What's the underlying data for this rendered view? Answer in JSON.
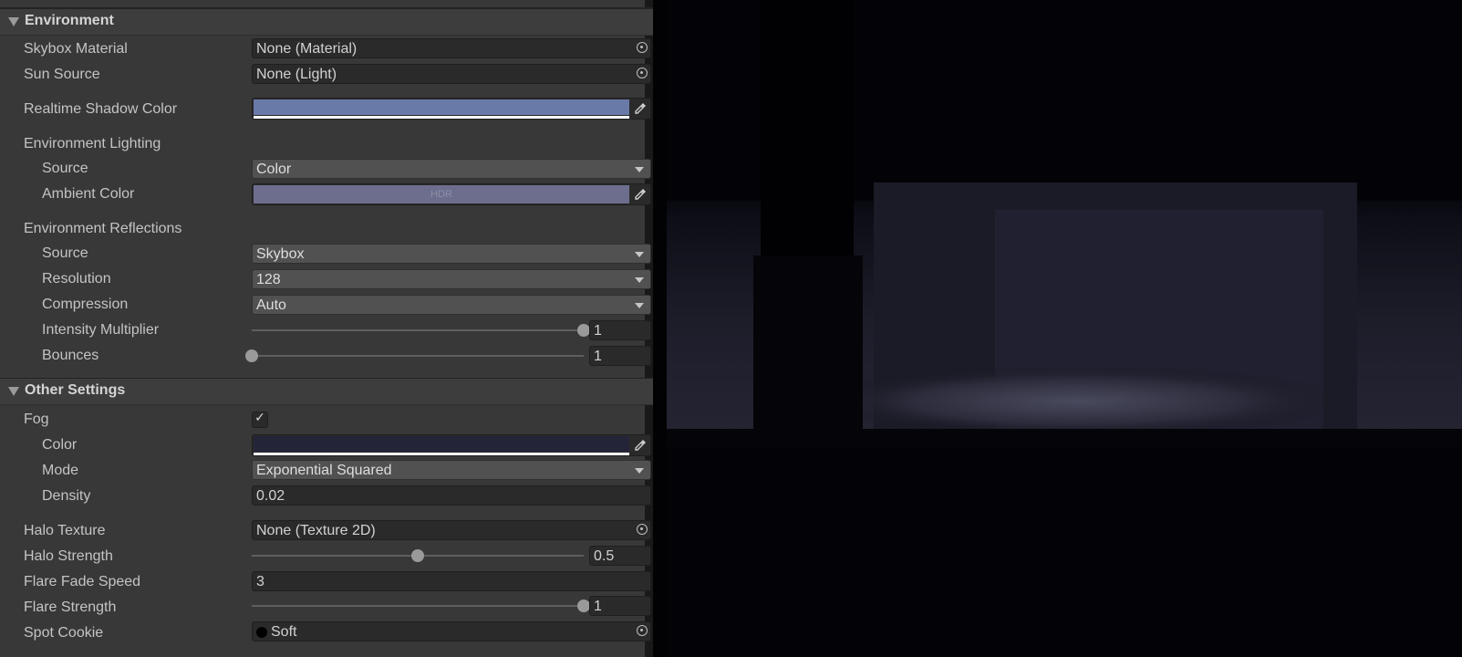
{
  "sections": {
    "environment": {
      "title": "Environment"
    },
    "other": {
      "title": "Other Settings"
    }
  },
  "environment": {
    "skybox_material": {
      "label": "Skybox Material",
      "value": "None (Material)"
    },
    "sun_source": {
      "label": "Sun Source",
      "value": "None (Light)"
    },
    "shadow_color": {
      "label": "Realtime Shadow Color",
      "color": "#6a7aa8"
    },
    "lighting": {
      "header": "Environment Lighting",
      "source": {
        "label": "Source",
        "value": "Color"
      },
      "ambient": {
        "label": "Ambient Color",
        "color": "#6d6e8e",
        "badge": "HDR"
      }
    },
    "reflections": {
      "header": "Environment Reflections",
      "source": {
        "label": "Source",
        "value": "Skybox"
      },
      "resolution": {
        "label": "Resolution",
        "value": "128"
      },
      "compression": {
        "label": "Compression",
        "value": "Auto"
      },
      "intensity": {
        "label": "Intensity Multiplier",
        "value": "1",
        "fraction": 1.0
      },
      "bounces": {
        "label": "Bounces",
        "value": "1",
        "fraction": 0.0
      }
    }
  },
  "other": {
    "fog": {
      "label": "Fog",
      "checked": true,
      "check_glyph": "✓"
    },
    "fog_color": {
      "label": "Color",
      "color": "#242439"
    },
    "mode": {
      "label": "Mode",
      "value": "Exponential Squared"
    },
    "density": {
      "label": "Density",
      "value": "0.02"
    },
    "halo_texture": {
      "label": "Halo Texture",
      "value": "None (Texture 2D)"
    },
    "halo_strength": {
      "label": "Halo Strength",
      "value": "0.5",
      "fraction": 0.5
    },
    "flare_fade_speed": {
      "label": "Flare Fade Speed",
      "value": "3"
    },
    "flare_strength": {
      "label": "Flare Strength",
      "value": "1",
      "fraction": 1.0
    },
    "spot_cookie": {
      "label": "Spot Cookie",
      "value": "Soft"
    }
  },
  "icons": {
    "fold": "triangle-down-icon",
    "object_picker": "object-picker-icon",
    "eyedropper": "eyedropper-icon",
    "dropdown": "chevron-down-icon"
  },
  "colors": {
    "panel_bg": "#383838",
    "scene_bg": "#030307"
  }
}
